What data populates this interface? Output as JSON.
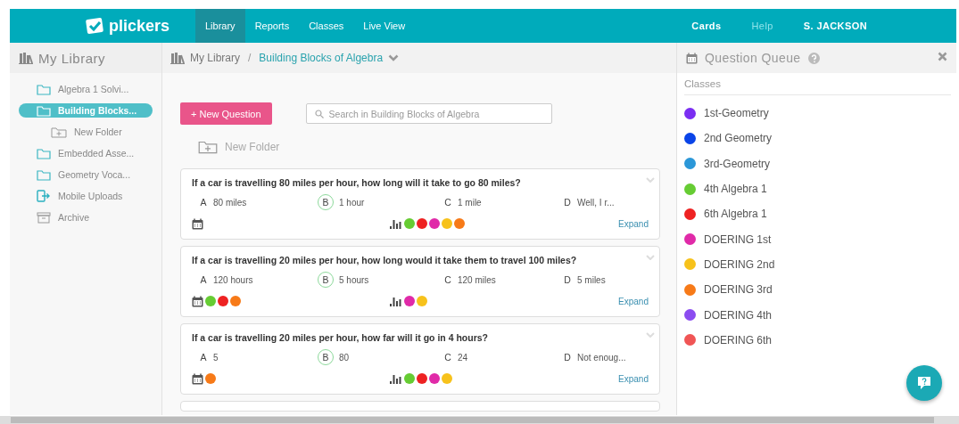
{
  "topbar": {
    "logo": "plickers",
    "nav": [
      {
        "label": "Library",
        "selected": true
      },
      {
        "label": "Reports",
        "selected": false
      },
      {
        "label": "Classes",
        "selected": false
      },
      {
        "label": "Live View",
        "selected": false
      }
    ],
    "right_links": [
      {
        "label": "Cards",
        "disabled": false
      },
      {
        "label": "Help",
        "disabled": true
      },
      {
        "label": "S. JACKSON",
        "disabled": false
      }
    ]
  },
  "sidebar": {
    "title": "My Library",
    "items": [
      {
        "label": "Algebra 1 Solvi...",
        "kind": "folder",
        "selected": false
      },
      {
        "label": "Building Blocks...",
        "kind": "folder",
        "selected": true,
        "children": [
          {
            "label": "New Folder",
            "kind": "new-folder",
            "selected": false
          }
        ]
      },
      {
        "label": "Embedded Asse...",
        "kind": "folder",
        "selected": false
      },
      {
        "label": "Geometry Voca...",
        "kind": "folder",
        "selected": false
      },
      {
        "label": "Mobile Uploads",
        "kind": "mobile",
        "selected": false
      },
      {
        "label": "Archive",
        "kind": "archive",
        "selected": false
      }
    ]
  },
  "breadcrumb": {
    "root": "My Library",
    "separator": "/",
    "current": "Building Blocks of Algebra"
  },
  "new_question_button": "+ New Question",
  "search": {
    "placeholder": "Search in Building Blocks of Algebra"
  },
  "new_folder": "New Folder",
  "questions": [
    {
      "text": "If a car is travelling 80 miles per hour, how long will it take to go 80 miles?",
      "choices": [
        {
          "letter": "A",
          "text": "80 miles",
          "correct": false
        },
        {
          "letter": "B",
          "text": "1 hour",
          "correct": true
        },
        {
          "letter": "C",
          "text": "1 mile",
          "correct": false
        },
        {
          "letter": "D",
          "text": "Well, I r...",
          "correct": false
        }
      ],
      "responses": [
        {
          "color": "#66cc33"
        },
        {
          "color": "#ee2222"
        },
        {
          "color": "#e02aa8"
        },
        {
          "color": "#f7c21b"
        },
        {
          "color": "#f77a18"
        }
      ],
      "expand": "Expand"
    },
    {
      "text": "If a car is travelling 20 miles per hour, how long would it take them to travel 100 miles?",
      "choices": [
        {
          "letter": "A",
          "text": "120 hours",
          "correct": false
        },
        {
          "letter": "B",
          "text": "5 hours",
          "correct": true
        },
        {
          "letter": "C",
          "text": "120 miles",
          "correct": false
        },
        {
          "letter": "D",
          "text": "5 miles",
          "correct": false
        }
      ],
      "scheduled": [
        {
          "color": "#66cc33"
        },
        {
          "color": "#ee2222"
        },
        {
          "color": "#f77a18"
        }
      ],
      "responses": [
        {
          "color": "#e02aa8"
        },
        {
          "color": "#f7c21b"
        }
      ],
      "expand": "Expand"
    },
    {
      "text": "If a car is travelling 20 miles per hour, how far will it go in 4 hours?",
      "choices": [
        {
          "letter": "A",
          "text": "5",
          "correct": false
        },
        {
          "letter": "B",
          "text": "80",
          "correct": true
        },
        {
          "letter": "C",
          "text": "24",
          "correct": false
        },
        {
          "letter": "D",
          "text": "Not enoug...",
          "correct": false
        }
      ],
      "scheduled": [
        {
          "color": "#f77a18"
        }
      ],
      "responses": [
        {
          "color": "#66cc33"
        },
        {
          "color": "#ee2222"
        },
        {
          "color": "#e02aa8"
        },
        {
          "color": "#f7c21b"
        }
      ],
      "expand": "Expand"
    }
  ],
  "queue": {
    "title": "Question Queue",
    "section": "Classes",
    "classes": [
      {
        "name": "1st-Geometry",
        "color": "#7b2ef2"
      },
      {
        "name": "2nd Geometry",
        "color": "#0a44e8"
      },
      {
        "name": "3rd-Geometry",
        "color": "#2b97d8"
      },
      {
        "name": "4th Algebra 1",
        "color": "#66cc33"
      },
      {
        "name": "6th Algebra 1",
        "color": "#ee2222"
      },
      {
        "name": "DOERING 1st",
        "color": "#e02aa8"
      },
      {
        "name": "DOERING 2nd",
        "color": "#f7c21b"
      },
      {
        "name": "DOERING 3rd",
        "color": "#f77a18"
      },
      {
        "name": "DOERING 4th",
        "color": "#8b4cf0"
      },
      {
        "name": "DOERING 6th",
        "color": "#f05555"
      }
    ]
  }
}
